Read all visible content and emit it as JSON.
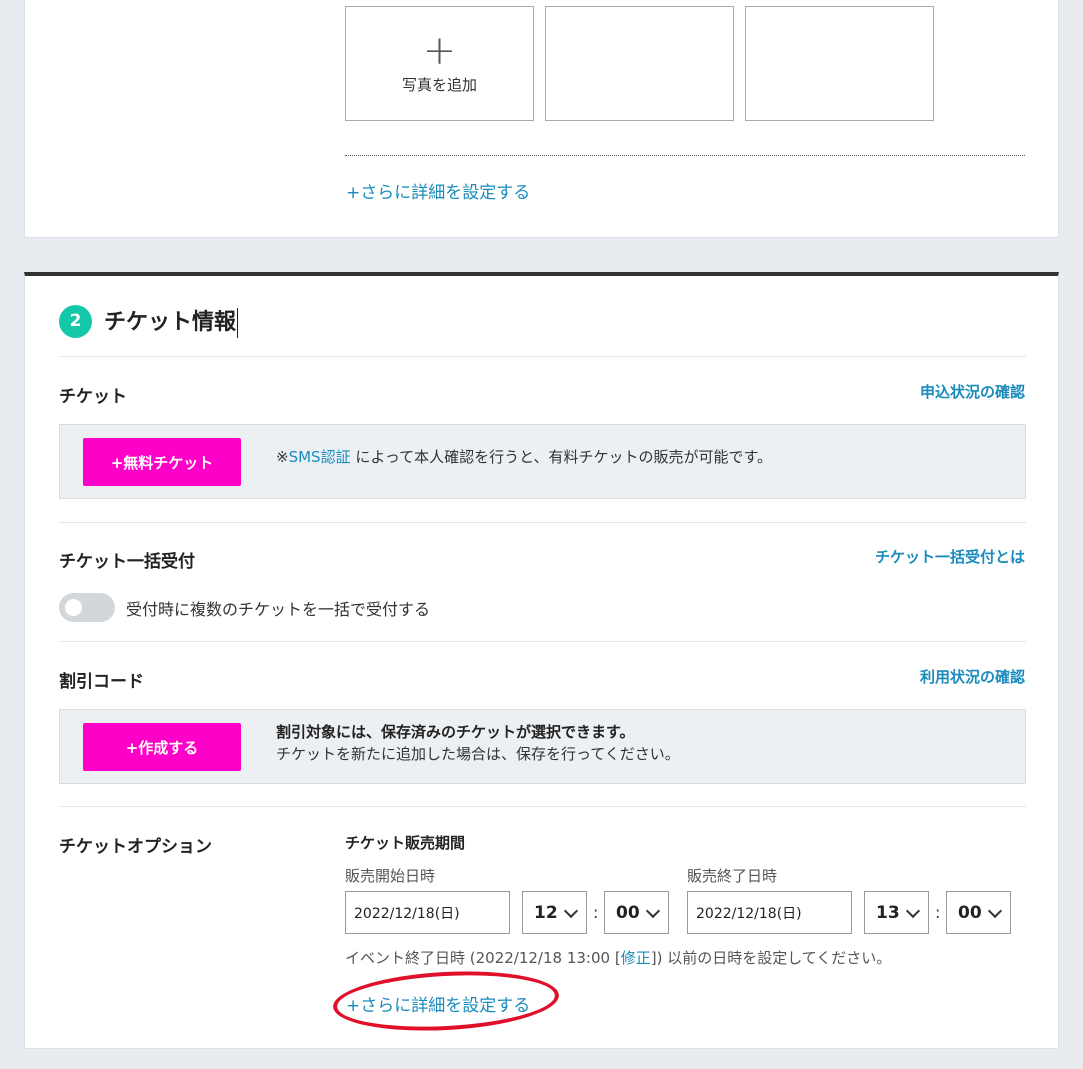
{
  "photos": {
    "add_icon": "+",
    "add_label": "写真を追加"
  },
  "basic": {
    "more_link": "+さらに詳細を設定する"
  },
  "section2": {
    "number": "2",
    "title": "チケット情報",
    "ticket": {
      "label": "チケット",
      "link": "申込状況の確認",
      "free_ticket_button": "+無料チケット",
      "note_prefix": "※",
      "note_link": "SMS認証",
      "note_suffix": " によって本人確認を行うと、有料チケットの販売が可能です。"
    },
    "bulk": {
      "label": "チケット一括受付",
      "link": "チケット一括受付とは",
      "toggle_label": "受付時に複数のチケットを一括で受付する"
    },
    "discount": {
      "label": "割引コード",
      "link": "利用状況の確認",
      "create_button": "+作成する",
      "note_bold": "割引対象には、保存済みのチケットが選択できます。",
      "note": "チケットを新たに追加した場合は、保存を行ってください。"
    },
    "options": {
      "label": "チケットオプション",
      "sale_period_title": "チケット販売期間",
      "start_label": "販売開始日時",
      "start_date": "2022/12/18(日)",
      "start_hour": "12",
      "start_min": "00",
      "end_label": "販売終了日時",
      "end_date": "2022/12/18(日)",
      "end_hour": "13",
      "end_min": "00",
      "colon": ":",
      "hint_prefix": "イベント終了日時 (2022/12/18 13:00 [",
      "hint_link": "修正",
      "hint_suffix": "]) 以前の日時を設定してください。",
      "more_link": "+さらに詳細を設定する"
    }
  },
  "colors": {
    "accent_link": "#1a8bbd",
    "pink_button": "#ff00c8",
    "badge_teal": "#14c7a8",
    "annotation_red": "#e0102a"
  }
}
